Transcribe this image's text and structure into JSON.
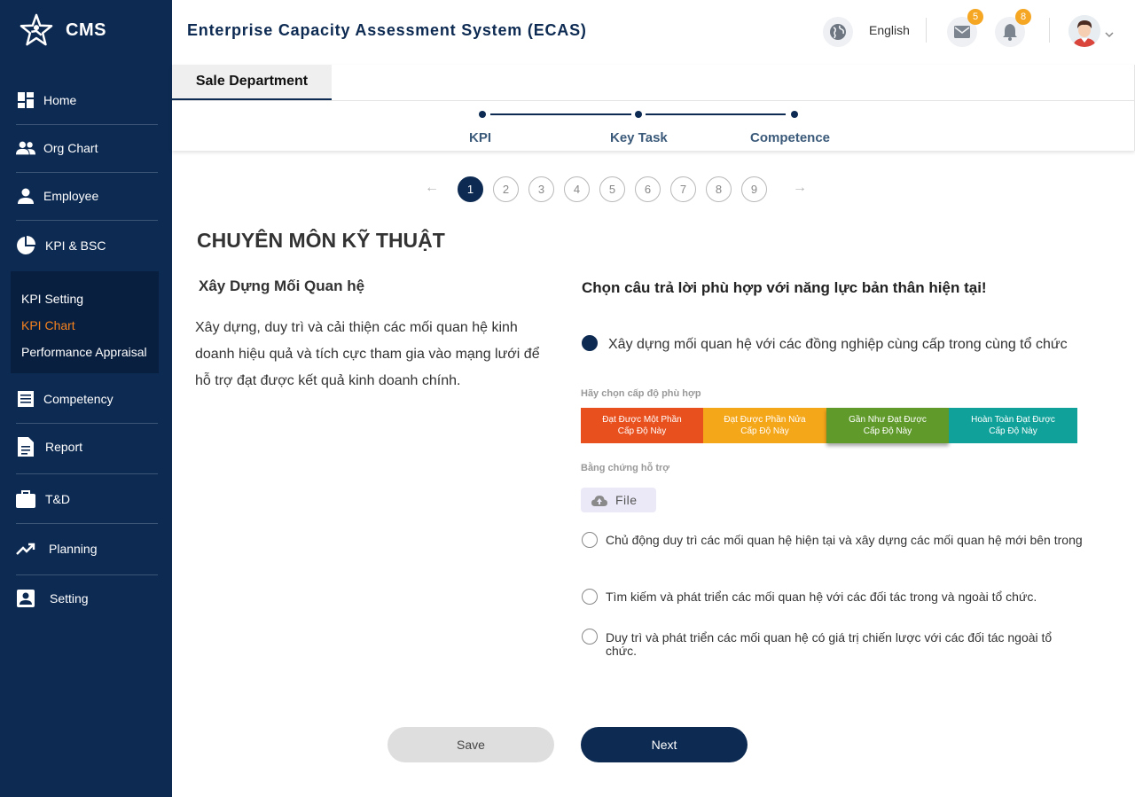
{
  "brand": {
    "name": "CMS"
  },
  "sidebar": {
    "items": [
      {
        "label": "Home",
        "icon": "dashboard-icon"
      },
      {
        "label": "Org Chart",
        "icon": "people-icon"
      },
      {
        "label": "Employee",
        "icon": "person-icon"
      },
      {
        "label": "KPI & BSC",
        "icon": "pie-chart-icon"
      },
      {
        "label": "Competency",
        "icon": "list-icon"
      },
      {
        "label": "Report",
        "icon": "document-icon"
      },
      {
        "label": "T&D",
        "icon": "briefcase-icon"
      },
      {
        "label": "Planning",
        "icon": "trending-up-icon"
      },
      {
        "label": "Setting",
        "icon": "account-box-icon"
      }
    ],
    "submenu": [
      {
        "label": "KPI Setting"
      },
      {
        "label": "KPI Chart"
      },
      {
        "label": "Performance Appraisal"
      }
    ]
  },
  "header": {
    "title": "Enterprise Capacity Assessment System (ECAS)",
    "language": "English",
    "mail_count": "5",
    "notification_count": "8"
  },
  "tabs": {
    "active": "Sale Department"
  },
  "stepper": {
    "steps": [
      "KPI",
      "Key Task",
      "Competence"
    ]
  },
  "pager": {
    "pages": [
      "1",
      "2",
      "3",
      "4",
      "5",
      "6",
      "7",
      "8",
      "9"
    ],
    "current": "1"
  },
  "section": {
    "title": "CHUYÊN MÔN KỸ THUẬT",
    "competency_name": "Xây Dựng Mối Quan hệ",
    "description": "Xây dựng, duy trì và cải thiện các mối quan hệ kinh doanh hiệu quả và tích cực tham gia vào mạng lưới để hỗ trợ đạt được kết quả kinh doanh chính."
  },
  "question": {
    "prompt": "Chọn câu trả lời phù hợp với năng lực bản thân hiện tại!",
    "options": [
      "Xây dựng mối quan hệ với các đồng nghiệp cùng cấp trong cùng tổ chức",
      "Chủ động duy trì các mối quan hệ hiện tại và xây dựng các mối quan hệ mới bên trong",
      "Tìm kiếm và phát triển các mối quan hệ với các đối tác trong và ngoài tổ chức.",
      "Duy trì và phát triển các mối quan hệ có giá trị chiến lược với các đối tác ngoài tổ chức."
    ],
    "selected_option": 0,
    "level_prompt": "Hãy chọn cấp độ phù hợp",
    "levels": [
      {
        "line1": "Đạt Được Một Phần",
        "line2": "Cấp Độ Này",
        "color": "#e8501e"
      },
      {
        "line1": "Đạt Được Phần Nửa",
        "line2": "Cấp Độ Này",
        "color": "#f5a71a"
      },
      {
        "line1": "Gần Như Đạt Được",
        "line2": "Cấp Độ Này",
        "color": "#5f9a2a"
      },
      {
        "line1": "Hoàn Toàn Đạt Được",
        "line2": "Cấp Độ Này",
        "color": "#10a29a"
      }
    ],
    "selected_level": 2,
    "evidence_label": "Bằng chứng hỗ trợ",
    "file_button": "File"
  },
  "actions": {
    "save": "Save",
    "next": "Next"
  },
  "colors": {
    "primary": "#0d2a52",
    "accent": "#f5821f",
    "badge": "#f5a623"
  }
}
